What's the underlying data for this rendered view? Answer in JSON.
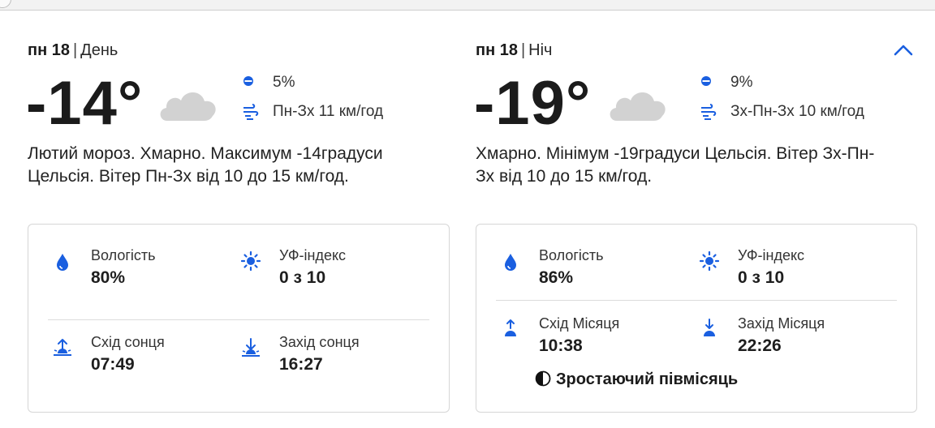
{
  "colors": {
    "accent": "#1a5fe0",
    "text": "#1b1b1b",
    "cloud": "#d2d2d2",
    "border": "#d6d6d6"
  },
  "collapse_icon": "chevron-up-icon",
  "day": {
    "date": "пн 18",
    "separator": "|",
    "period": "День",
    "temperature": "-14°",
    "condition_icon": "cloud-icon",
    "precip": {
      "icon": "precipitation-dot-icon",
      "value": "5%"
    },
    "wind": {
      "icon": "wind-icon",
      "value": "Пн-Зх 11 км/год"
    },
    "description": "Лютий мороз. Хмарно. Максимум -14градуси Цельсія. Вітер Пн-Зх від 10 до 15 км/год.",
    "details": {
      "humidity": {
        "icon": "water-drop-icon",
        "label": "Вологість",
        "value": "80%"
      },
      "uv": {
        "icon": "sun-uv-icon",
        "label": "УФ-індекс",
        "value": "0 з 10"
      },
      "rise": {
        "icon": "sunrise-icon",
        "label": "Схід сонця",
        "value": "07:49"
      },
      "set": {
        "icon": "sunset-icon",
        "label": "Захід сонця",
        "value": "16:27"
      }
    }
  },
  "night": {
    "date": "пн 18",
    "separator": "|",
    "period": "Ніч",
    "temperature": "-19°",
    "condition_icon": "cloud-icon",
    "precip": {
      "icon": "precipitation-dot-icon",
      "value": "9%"
    },
    "wind": {
      "icon": "wind-icon",
      "value": "Зх-Пн-Зх 10 км/год"
    },
    "description": "Хмарно. Мінімум -19градуси Цельсія. Вітер Зх-Пн-Зх від 10 до 15 км/год.",
    "details": {
      "humidity": {
        "icon": "water-drop-icon",
        "label": "Вологість",
        "value": "86%"
      },
      "uv": {
        "icon": "sun-uv-icon",
        "label": "УФ-індекс",
        "value": "0 з 10"
      },
      "rise": {
        "icon": "moonrise-icon",
        "label": "Схід Місяця",
        "value": "10:38"
      },
      "set": {
        "icon": "moonset-icon",
        "label": "Захід Місяця",
        "value": "22:26"
      },
      "moon_phase": {
        "icon": "half-moon-icon",
        "label": "Зростаючий півмісяць"
      }
    }
  }
}
